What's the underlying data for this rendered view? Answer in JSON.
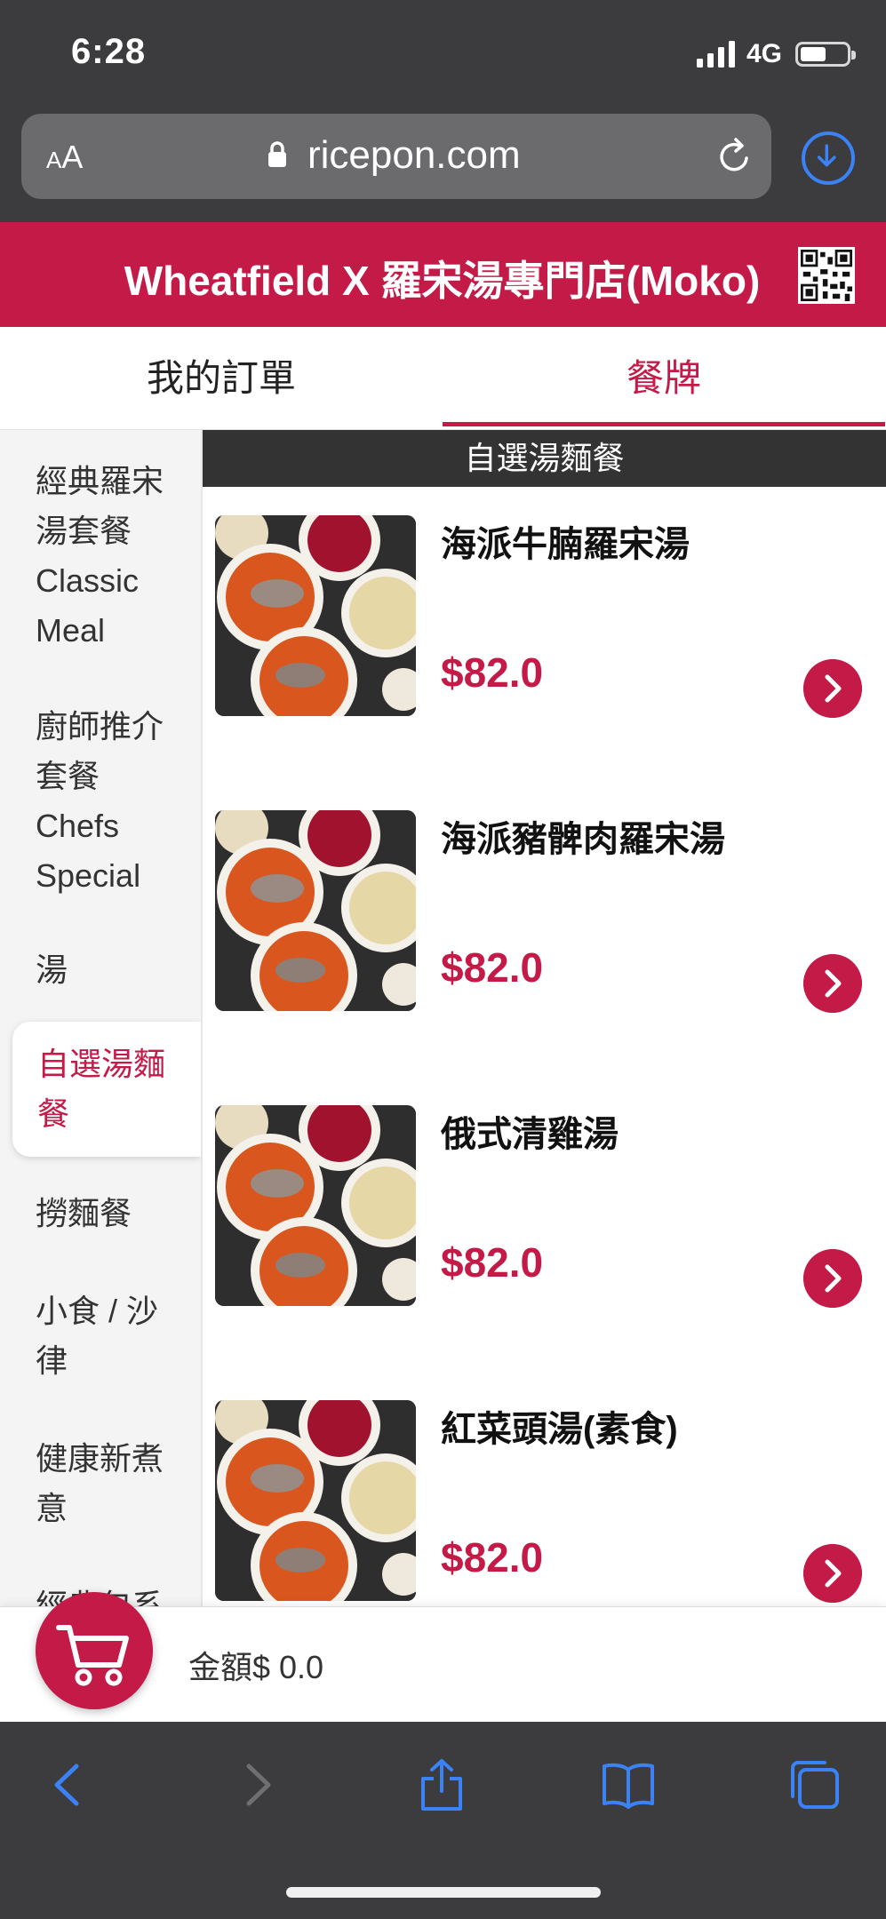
{
  "status_bar": {
    "time": "6:28",
    "network": "4G",
    "battery_level": 0.55
  },
  "browser": {
    "text_size_label_small": "A",
    "text_size_label_large": "A",
    "domain": "ricepon.com"
  },
  "store": {
    "name": "Wheatfield X 羅宋湯專門店(Moko)"
  },
  "tabs": {
    "orders": "我的訂單",
    "menu": "餐牌"
  },
  "categories": [
    {
      "label": "經典羅宋湯套餐 Classic Meal",
      "active": false
    },
    {
      "label": "廚師推介套餐 Chefs Special",
      "active": false
    },
    {
      "label": "湯",
      "active": false
    },
    {
      "label": "自選湯麵餐",
      "active": true
    },
    {
      "label": "撈麵餐",
      "active": false
    },
    {
      "label": "小食 / 沙律",
      "active": false
    },
    {
      "label": "健康新煮意",
      "active": false
    },
    {
      "label": "經典包系",
      "active": false
    }
  ],
  "section": {
    "title": "自選湯麵餐"
  },
  "items": [
    {
      "name": "海派牛腩羅宋湯",
      "price": "$82.0"
    },
    {
      "name": "海派豬髀肉羅宋湯",
      "price": "$82.0"
    },
    {
      "name": "俄式清雞湯",
      "price": "$82.0"
    },
    {
      "name": "紅菜頭湯(素食)",
      "price": "$82.0"
    }
  ],
  "cart": {
    "total_label": "金額$ 0.0"
  },
  "colors": {
    "brand": "#c41a47",
    "toolbar_bg": "#3c3c3e",
    "ios_blue": "#3b82f6"
  },
  "icons": {
    "signal": "signal-icon",
    "battery": "battery-icon",
    "lock": "lock-icon",
    "reload": "reload-icon",
    "download": "download-icon",
    "qr": "qr-code-icon",
    "cart": "cart-icon",
    "chevron": "chevron-right-icon",
    "back": "back-icon",
    "forward": "forward-icon",
    "share": "share-icon",
    "bookmarks": "bookmarks-icon",
    "tabs": "tabs-icon"
  }
}
